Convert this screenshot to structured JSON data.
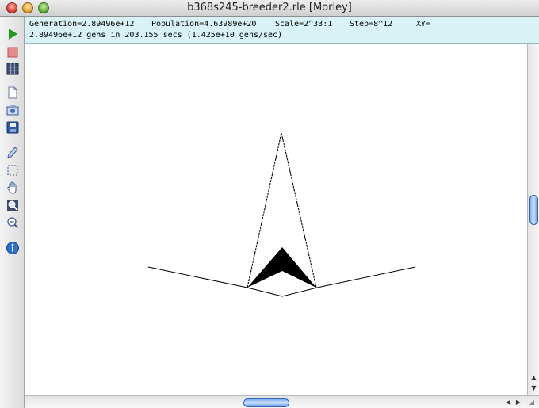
{
  "window": {
    "title": "b368s245-breeder2.rle [Morley]"
  },
  "status": {
    "generation": "Generation=2.89496e+12",
    "population": "Population=4.63989e+20",
    "scale": "Scale=2^33:1",
    "step": "Step=8^12",
    "xy": "XY=",
    "summary": "2.89496e+12 gens in 203.155 secs (1.425e+10 gens/sec)"
  },
  "toolbar": {
    "tools": [
      {
        "name": "start-generating",
        "icon": "play-icon"
      },
      {
        "name": "stop-generating",
        "icon": "stop-icon"
      },
      {
        "name": "hashing",
        "icon": "grid-icon"
      },
      {
        "name": "new-pattern",
        "icon": "document-icon"
      },
      {
        "name": "open-pattern",
        "icon": "open-icon"
      },
      {
        "name": "save-pattern",
        "icon": "save-icon"
      },
      {
        "name": "draw-mode",
        "icon": "pencil-icon"
      },
      {
        "name": "select-mode",
        "icon": "select-icon"
      },
      {
        "name": "move-mode",
        "icon": "hand-icon"
      },
      {
        "name": "zoom-in-mode",
        "icon": "zoom-in-icon"
      },
      {
        "name": "zoom-out-mode",
        "icon": "zoom-out-icon"
      },
      {
        "name": "show-info",
        "icon": "info-icon"
      }
    ]
  },
  "colors": {
    "status_bg": "#d8f2f5",
    "play_green": "#1f9a1f",
    "stop_red": "#d04040",
    "info_blue": "#2f6fd0",
    "pattern": "#000000",
    "scroll_thumb": "#7fb0f0"
  }
}
